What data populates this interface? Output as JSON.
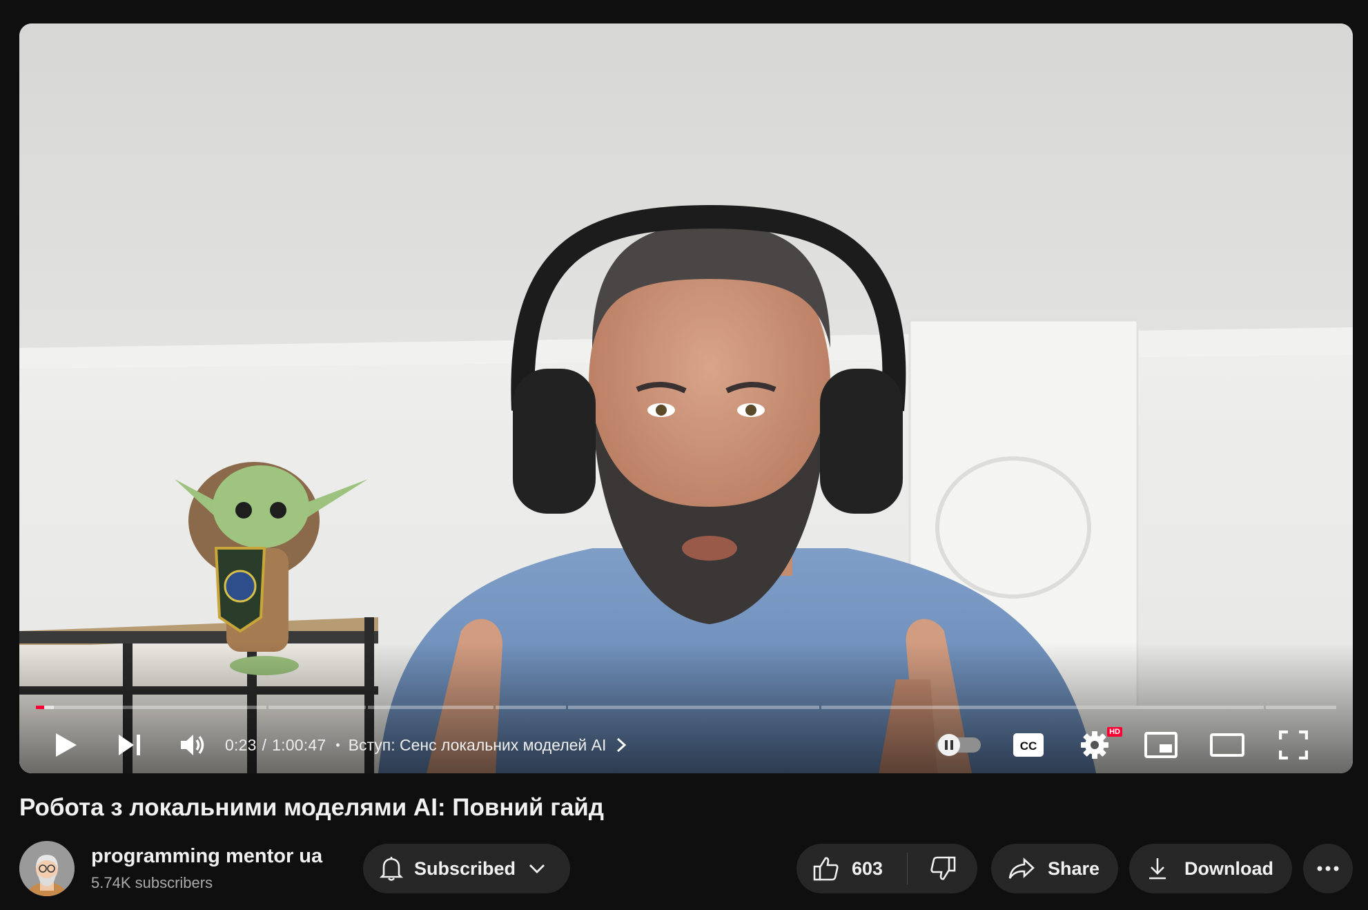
{
  "player": {
    "current_time": "0:23",
    "time_separator": "/",
    "duration": "1:00:47",
    "chapter_separator": "•",
    "chapter_title": "Вступ: Сенс локальних моделей AI",
    "played_fraction": 0.0063,
    "settings_badge": "HD",
    "icons": [
      "play-icon",
      "next-icon",
      "volume-icon",
      "chevron-right-icon",
      "autoplay-toggle-icon",
      "cc-icon",
      "settings-icon",
      "miniplayer-icon",
      "theater-icon",
      "fullscreen-icon"
    ],
    "chapters": [
      {
        "fraction": 0.1386
      },
      {
        "fraction": 0.0586
      },
      {
        "fraction": 0.0755
      },
      {
        "fraction": 0.0424
      },
      {
        "fraction": 0.1513
      },
      {
        "fraction": 0.266
      },
      {
        "fraction": 0.0424
      }
    ]
  },
  "video": {
    "title": "Робота з локальними моделями AI: Повний гайд"
  },
  "channel": {
    "name": "programming mentor ua",
    "subscribers": "5.74K subscribers"
  },
  "actions": {
    "subscribe_label": "Subscribed",
    "like_count": "603",
    "share_label": "Share",
    "download_label": "Download"
  },
  "colors": {
    "background": "#0f0f0f",
    "pill": "#272727",
    "progress_played": "#ff0033",
    "text_secondary": "#aaaaaa"
  }
}
